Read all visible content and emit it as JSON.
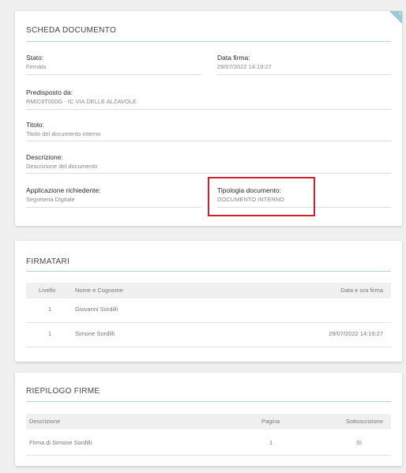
{
  "scheda": {
    "title": "SCHEDA DOCUMENTO",
    "fields": {
      "stato_label": "Stato:",
      "stato_value": "Firmato",
      "data_firma_label": "Data firma:",
      "data_firma_value": "29/07/2022 14:19:27",
      "predisposto_label": "Predisposto da:",
      "predisposto_value": "RMIC8T000G - IC VIA DELLE ALZAVOLE",
      "titolo_label": "Titolo:",
      "titolo_value": "Titolo del documento interno",
      "descrizione_label": "Descrizione:",
      "descrizione_value": "Descrizione del documento",
      "applicazione_label": "Applicazione richiedente:",
      "applicazione_value": "Segreteria Digitale",
      "tipologia_label": "Tipologia documento:",
      "tipologia_value": "DOCUMENTO INTERNO"
    },
    "corner_icon": "info-icon",
    "corner_glyph": "i",
    "highlight_color": "#d0202a"
  },
  "firmatari": {
    "title": "FIRMATARI",
    "headers": [
      "Livello",
      "Nome e Cognome",
      "Data e ora firma"
    ],
    "rows": [
      {
        "livello": "1",
        "nome": "Giovanni Sordilli",
        "data": ""
      },
      {
        "livello": "1",
        "nome": "Simone Sordilli",
        "data": "29/07/2022 14:19:27"
      }
    ]
  },
  "riepilogo": {
    "title": "RIEPILOGO FIRME",
    "headers": [
      "Descrizione",
      "Pagina",
      "Sottoscrizione"
    ],
    "rows": [
      {
        "descrizione": "Firma di Simone Sordilli",
        "pagina": "1",
        "sottoscrizione": "Sì"
      }
    ]
  },
  "colors": {
    "accent_rule": "#a9d6c8",
    "page_bg": "#f0f0f0"
  }
}
